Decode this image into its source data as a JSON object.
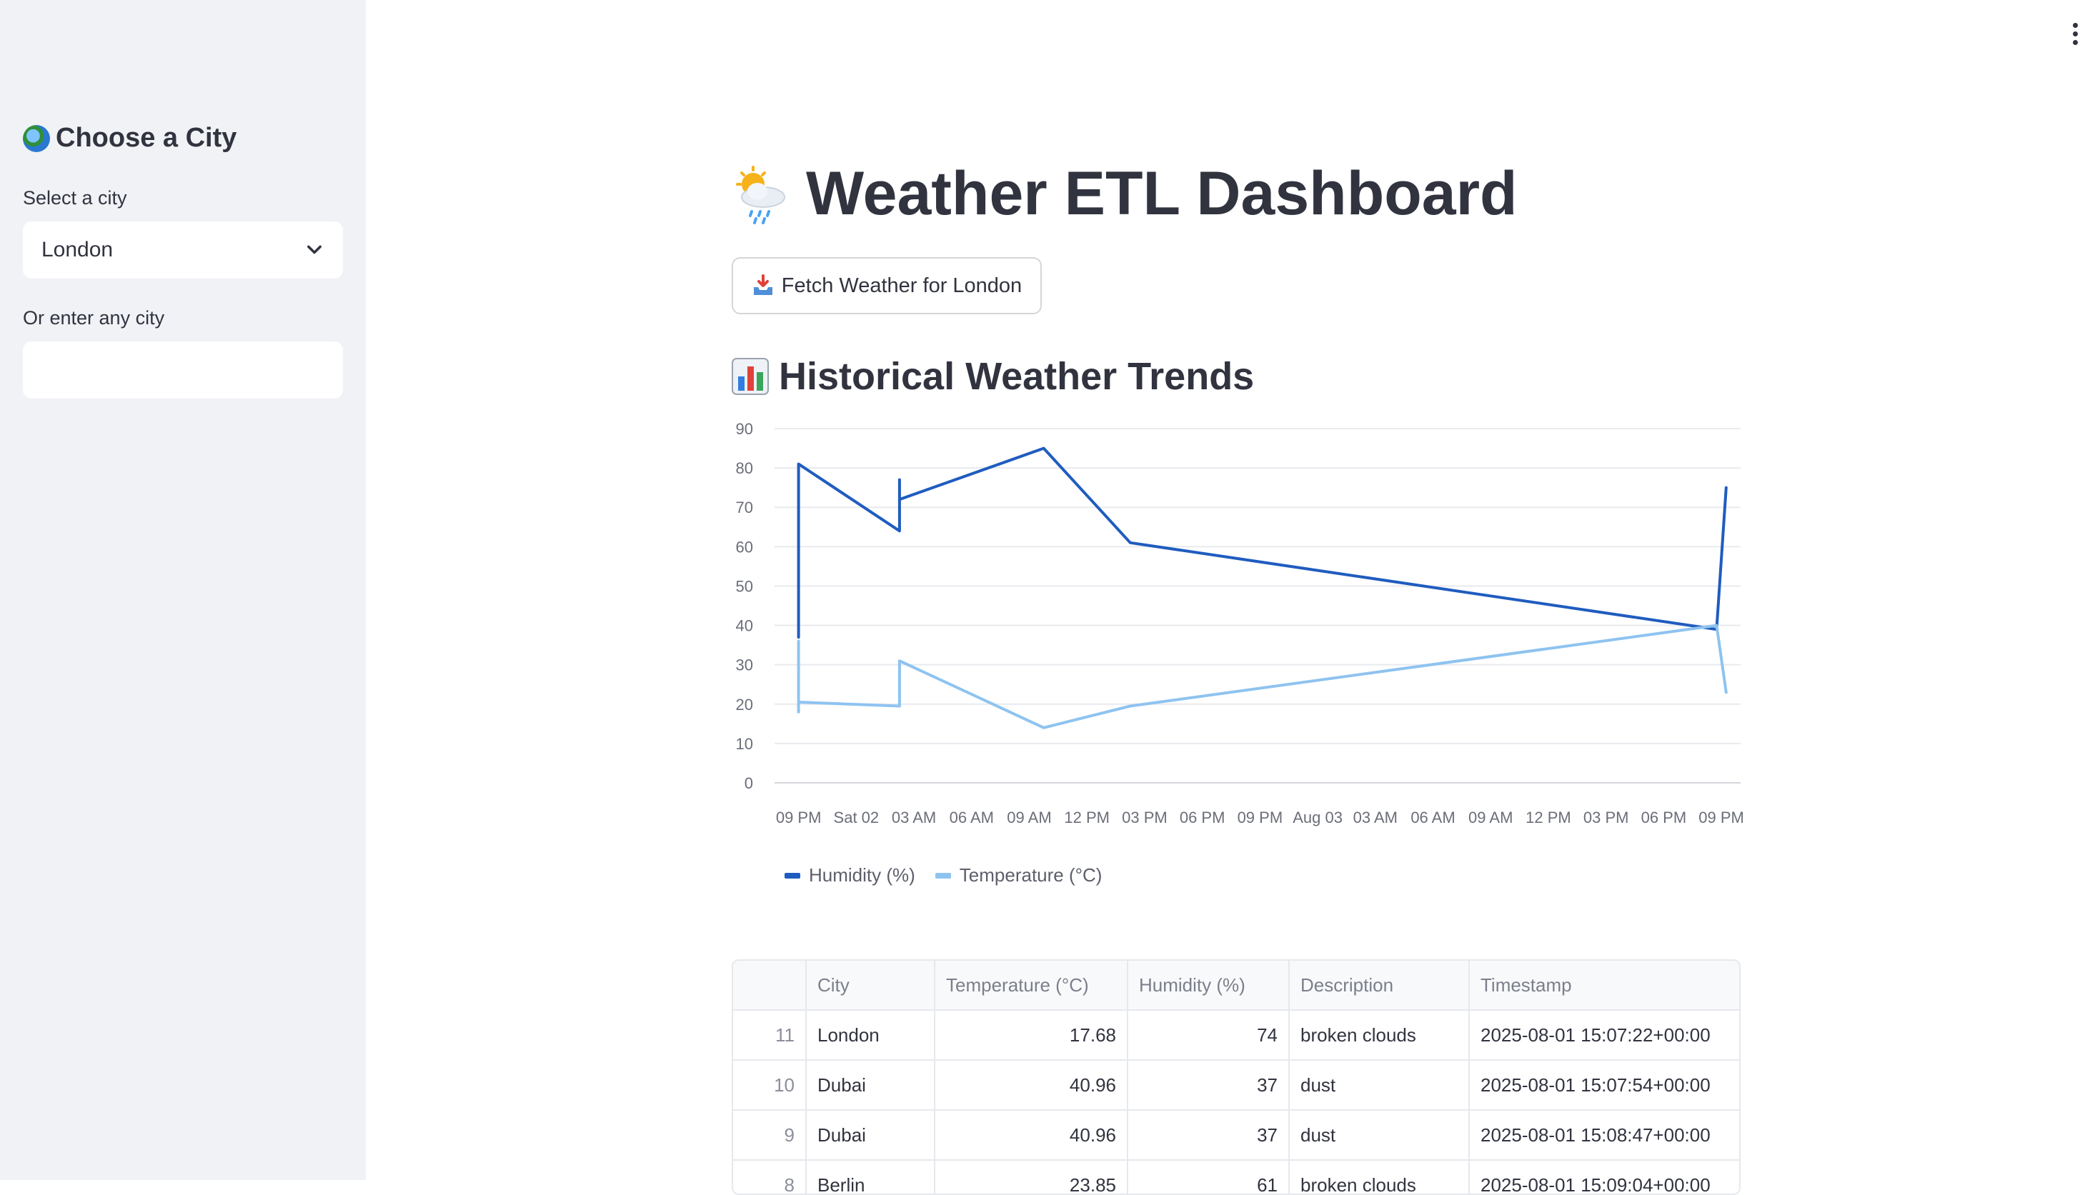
{
  "sidebar": {
    "title": "Choose a City",
    "select_label": "Select a city",
    "select_value": "London",
    "input_label": "Or enter any city",
    "input_value": "",
    "icon": "globe-icon"
  },
  "main": {
    "title": "Weather ETL Dashboard",
    "title_icon": "sun-behind-rain-cloud-icon",
    "fetch_button": "Fetch Weather for London",
    "fetch_icon": "inbox-tray-icon",
    "section_title": "Historical Weather Trends",
    "section_icon": "bar-chart-icon"
  },
  "chart_data": {
    "type": "line",
    "x_ticks": [
      "09 PM",
      "Sat 02",
      "03 AM",
      "06 AM",
      "09 AM",
      "12 PM",
      "03 PM",
      "06 PM",
      "09 PM",
      "Aug 03",
      "03 AM",
      "06 AM",
      "09 AM",
      "12 PM",
      "03 PM",
      "06 PM",
      "09 PM"
    ],
    "ylim": [
      0,
      90
    ],
    "y_ticks": [
      0,
      10,
      20,
      30,
      40,
      50,
      60,
      70,
      80,
      90
    ],
    "grid": true,
    "legend_position": "bottom",
    "series": [
      {
        "name": "Humidity (%)",
        "color": "#1f5cbf",
        "points": [
          {
            "x": "2025-08-01 21:00",
            "y": 37
          },
          {
            "x": "2025-08-01 21:00",
            "y": 70
          },
          {
            "x": "2025-08-01 21:00",
            "y": 81
          },
          {
            "x": "2025-08-02 02:15",
            "y": 64
          },
          {
            "x": "2025-08-02 02:15",
            "y": 77
          },
          {
            "x": "2025-08-02 02:15",
            "y": 72
          },
          {
            "x": "2025-08-02 09:45",
            "y": 85
          },
          {
            "x": "2025-08-02 14:15",
            "y": 61
          },
          {
            "x": "2025-08-03 20:45",
            "y": 39
          },
          {
            "x": "2025-08-03 21:15",
            "y": 75
          }
        ]
      },
      {
        "name": "Temperature (°C)",
        "color": "#8ec3f0",
        "points": [
          {
            "x": "2025-08-01 21:00",
            "y": 18
          },
          {
            "x": "2025-08-01 21:00",
            "y": 36
          },
          {
            "x": "2025-08-01 21:00",
            "y": 20.5
          },
          {
            "x": "2025-08-02 02:15",
            "y": 19.5
          },
          {
            "x": "2025-08-02 02:15",
            "y": 31
          },
          {
            "x": "2025-08-02 09:45",
            "y": 14
          },
          {
            "x": "2025-08-02 14:15",
            "y": 19.5
          },
          {
            "x": "2025-08-03 20:45",
            "y": 40
          },
          {
            "x": "2025-08-03 21:15",
            "y": 23
          }
        ]
      }
    ]
  },
  "table": {
    "columns": [
      "",
      "City",
      "Temperature (°C)",
      "Humidity (%)",
      "Description",
      "Timestamp"
    ],
    "rows": [
      [
        "11",
        "London",
        "17.68",
        "74",
        "broken clouds",
        "2025-08-01 15:07:22+00:00"
      ],
      [
        "10",
        "Dubai",
        "40.96",
        "37",
        "dust",
        "2025-08-01 15:07:54+00:00"
      ],
      [
        "9",
        "Dubai",
        "40.96",
        "37",
        "dust",
        "2025-08-01 15:08:47+00:00"
      ],
      [
        "8",
        "Berlin",
        "23.85",
        "61",
        "broken clouds",
        "2025-08-01 15:09:04+00:00"
      ]
    ]
  }
}
